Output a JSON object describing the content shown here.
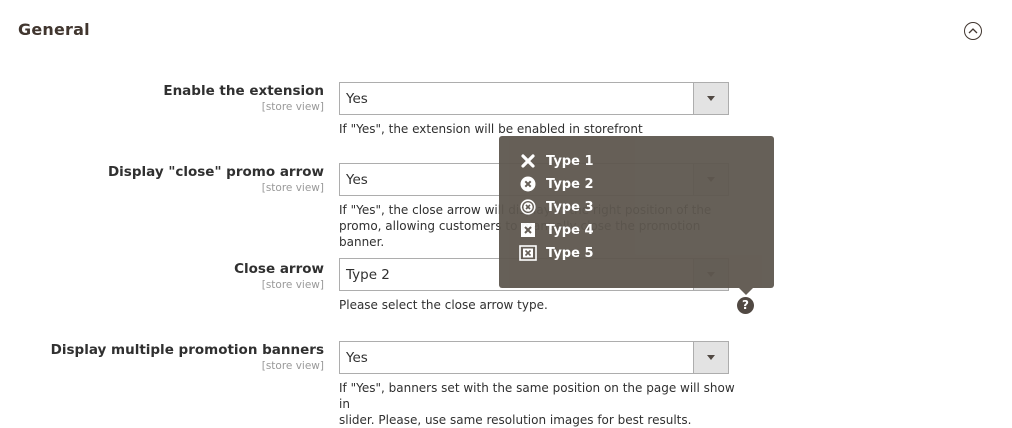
{
  "section": {
    "title": "General"
  },
  "fields": [
    {
      "label": "Enable the extension",
      "scope": "[store view]",
      "value": "Yes",
      "note": "If \"Yes\", the extension will be enabled in storefront"
    },
    {
      "label": "Display \"close\" promo arrow",
      "scope": "[store view]",
      "value": "Yes",
      "note_line1": "If \"Yes\", the close arrow will display in the right position of the",
      "note_line2": "promo, allowing customers to manually close the promotion banner."
    },
    {
      "label": "Close arrow",
      "scope": "[store view]",
      "value": "Type 2",
      "note": "Please select the close arrow type."
    },
    {
      "label": "Display multiple promotion banners",
      "scope": "[store view]",
      "value": "Yes",
      "note_line1": "If \"Yes\", banners set with the same position on the page will show in",
      "note_line2": "slider. Please, use same resolution images for best results."
    }
  ],
  "help": {
    "glyph": "?"
  },
  "tooltip": {
    "items": [
      {
        "label": "Type 1",
        "icon": "x-icon"
      },
      {
        "label": "Type 2",
        "icon": "x-circle-icon"
      },
      {
        "label": "Type 3",
        "icon": "x-circle-outline-icon"
      },
      {
        "label": "Type 4",
        "icon": "x-square-icon"
      },
      {
        "label": "Type 5",
        "icon": "x-square-outline-icon"
      }
    ]
  }
}
